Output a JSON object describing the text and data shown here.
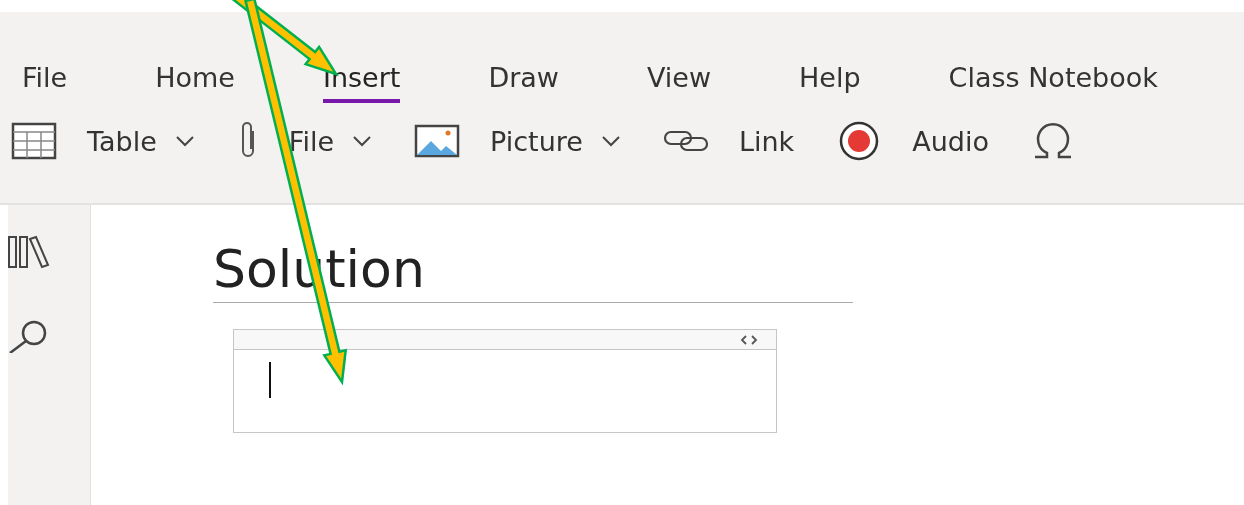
{
  "tabs": [
    {
      "label": "File",
      "selected": false
    },
    {
      "label": "Home",
      "selected": false
    },
    {
      "label": "Insert",
      "selected": true
    },
    {
      "label": "Draw",
      "selected": false
    },
    {
      "label": "View",
      "selected": false
    },
    {
      "label": "Help",
      "selected": false
    },
    {
      "label": "Class Notebook",
      "selected": false
    }
  ],
  "toolbar": [
    {
      "label": "Table",
      "dropdown": true
    },
    {
      "label": "File",
      "dropdown": true
    },
    {
      "label": "Picture",
      "dropdown": true
    },
    {
      "label": "Link",
      "dropdown": false
    },
    {
      "label": "Audio",
      "dropdown": false
    }
  ],
  "page": {
    "title": "Solution"
  }
}
